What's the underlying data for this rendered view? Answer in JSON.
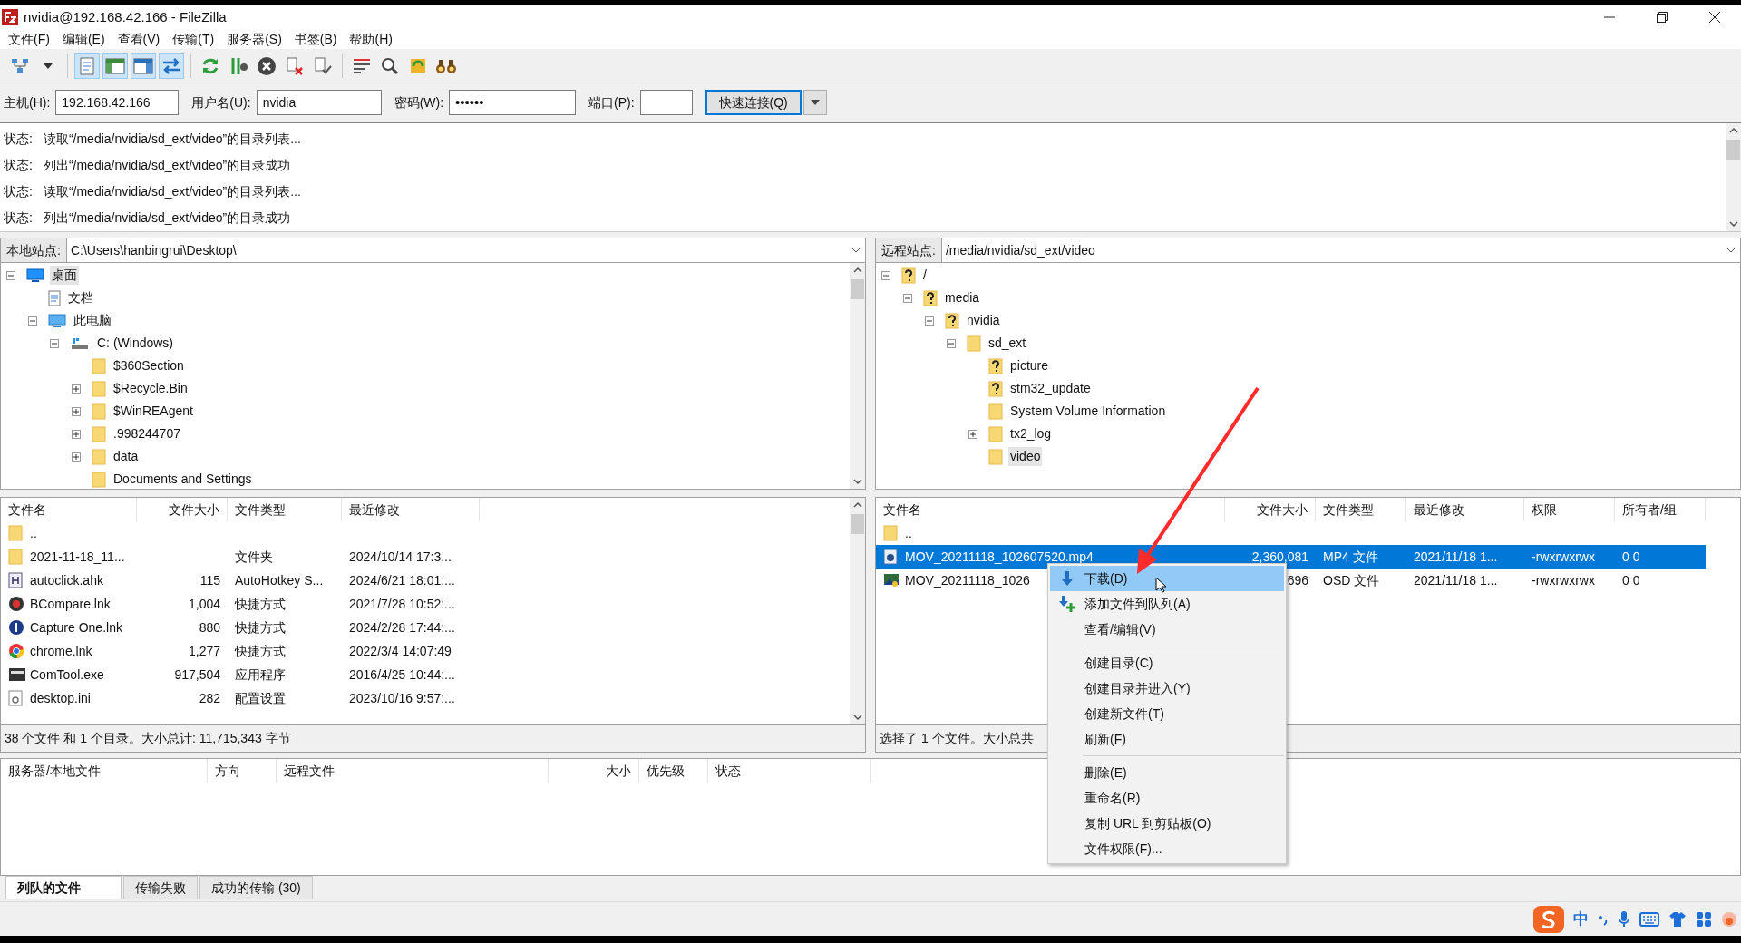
{
  "window": {
    "title": "nvidia@192.168.42.166 - FileZilla"
  },
  "menu": [
    "文件(F)",
    "编辑(E)",
    "查看(V)",
    "传输(T)",
    "服务器(S)",
    "书签(B)",
    "帮助(H)"
  ],
  "toolbar": [
    {
      "kind": "sitemanager"
    },
    {
      "kind": "dropdown"
    },
    {
      "kind": "sep"
    },
    {
      "kind": "log",
      "selected": true
    },
    {
      "kind": "localtree",
      "selected": true
    },
    {
      "kind": "remotetree",
      "selected": true
    },
    {
      "kind": "queue",
      "selected": true
    },
    {
      "kind": "sep"
    },
    {
      "kind": "refresh"
    },
    {
      "kind": "filter"
    },
    {
      "kind": "cancel"
    },
    {
      "kind": "disconnect"
    },
    {
      "kind": "reconnect"
    },
    {
      "kind": "sep"
    },
    {
      "kind": "list"
    },
    {
      "kind": "search"
    },
    {
      "kind": "sync"
    },
    {
      "kind": "find"
    }
  ],
  "quickconnect": {
    "host_label": "主机(H):",
    "host": "192.168.42.166",
    "user_label": "用户名(U):",
    "user": "nvidia",
    "password_label": "密码(W):",
    "password": "••••••",
    "port_label": "端口(P):",
    "connect": "快速连接(Q)"
  },
  "log": [
    {
      "label": "状态:",
      "text": "读取“/media/nvidia/sd_ext/video”的目录列表..."
    },
    {
      "label": "状态:",
      "text": "列出“/media/nvidia/sd_ext/video”的目录成功"
    },
    {
      "label": "状态:",
      "text": "读取“/media/nvidia/sd_ext/video”的目录列表..."
    },
    {
      "label": "状态:",
      "text": "列出“/media/nvidia/sd_ext/video”的目录成功"
    }
  ],
  "local": {
    "site_label": "本地站点:",
    "path": "C:\\Users\\hanbingrui\\Desktop\\",
    "tree": [
      {
        "name": "桌面",
        "kind": "desktop",
        "expanded": true,
        "selected": true,
        "children": [
          {
            "name": "文档",
            "kind": "document",
            "selected": false
          },
          {
            "name": "此电脑",
            "kind": "computer",
            "expanded": true,
            "selected": false,
            "children": [
              {
                "name": "C: (Windows)",
                "kind": "drive",
                "expanded": true,
                "selected": false,
                "children": [
                  {
                    "name": "$360Section",
                    "kind": "folder",
                    "selected": false
                  },
                  {
                    "name": "$Recycle.Bin",
                    "kind": "folder",
                    "expanded": false,
                    "selected": false
                  },
                  {
                    "name": "$WinREAgent",
                    "kind": "folder",
                    "expanded": false,
                    "selected": false
                  },
                  {
                    "name": ".998244707",
                    "kind": "folder",
                    "expanded": false,
                    "selected": false
                  },
                  {
                    "name": "data",
                    "kind": "folder",
                    "expanded": false,
                    "selected": false
                  },
                  {
                    "name": "Documents and Settings",
                    "kind": "folder",
                    "selected": false
                  }
                ]
              }
            ]
          }
        ]
      }
    ],
    "columns": [
      "文件名",
      "文件大小",
      "文件类型",
      "最近修改"
    ],
    "rows": [
      {
        "kind": "folder",
        "name": "..",
        "size": "",
        "type": "",
        "modified": "",
        "selected": false
      },
      {
        "kind": "folder",
        "name": "2021-11-18_11...",
        "type": "文件夹",
        "modified": "2024/10/14 17:3...",
        "selected": false
      },
      {
        "kind": "script",
        "name": "autoclick.ahk",
        "size": "115",
        "type": "AutoHotkey S...",
        "modified": "2024/6/21 18:01:...",
        "selected": false
      },
      {
        "kind": "compare",
        "name": "BCompare.lnk",
        "size": "1,004",
        "type": "快捷方式",
        "modified": "2021/7/28 10:52:...",
        "selected": false
      },
      {
        "kind": "capture",
        "name": "Capture One.lnk",
        "size": "880",
        "type": "快捷方式",
        "modified": "2024/2/28 17:44:...",
        "selected": false
      },
      {
        "kind": "chrome",
        "name": "chrome.lnk",
        "size": "1,277",
        "type": "快捷方式",
        "modified": "2022/3/4 14:07:49",
        "selected": false
      },
      {
        "kind": "exe",
        "name": "ComTool.exe",
        "size": "917,504",
        "type": "应用程序",
        "modified": "2016/4/25 10:44:...",
        "selected": false
      },
      {
        "kind": "ini",
        "name": "desktop.ini",
        "size": "282",
        "type": "配置设置",
        "modified": "2023/10/16 9:57:...",
        "selected": false
      }
    ],
    "status": "38 个文件 和 1 个目录。大小总计: 11,715,343 字节"
  },
  "remote": {
    "site_label": "远程站点:",
    "path": "/media/nvidia/sd_ext/video",
    "tree": [
      {
        "name": "/",
        "kind": "unknown",
        "expanded": true,
        "selected": false,
        "children": [
          {
            "name": "media",
            "kind": "unknown",
            "expanded": true,
            "selected": false,
            "children": [
              {
                "name": "nvidia",
                "kind": "unknown",
                "expanded": true,
                "selected": false,
                "children": [
                  {
                    "name": "sd_ext",
                    "kind": "folder",
                    "expanded": true,
                    "selected": false,
                    "children": [
                      {
                        "name": "picture",
                        "kind": "unknown",
                        "selected": false
                      },
                      {
                        "name": "stm32_update",
                        "kind": "unknown",
                        "selected": false
                      },
                      {
                        "name": "System Volume Information",
                        "kind": "folder",
                        "selected": false
                      },
                      {
                        "name": "tx2_log",
                        "kind": "folder",
                        "expanded": false,
                        "selected": false
                      },
                      {
                        "name": "video",
                        "kind": "folder",
                        "selected": true
                      }
                    ]
                  }
                ]
              }
            ]
          }
        ]
      }
    ],
    "columns": [
      "文件名",
      "文件大小",
      "文件类型",
      "最近修改",
      "权限",
      "所有者/组"
    ],
    "rows": [
      {
        "kind": "folder",
        "name": "..",
        "selected": false
      },
      {
        "kind": "video",
        "name": "MOV_20211118_102607520.mp4",
        "size": "2,360,081",
        "type": "MP4 文件",
        "modified": "2021/11/18 1...",
        "perm": "-rwxrwxrwx",
        "owner": "0 0",
        "selected": true
      },
      {
        "kind": "osd",
        "name": "MOV_20211118_1026",
        "size": "696",
        "type": "OSD 文件",
        "modified": "2021/11/18 1...",
        "perm": "-rwxrwxrwx",
        "owner": "0 0",
        "selected": false
      }
    ],
    "status": "选择了 1 个文件。大小总共"
  },
  "context_menu": {
    "groups": [
      [
        {
          "label": "下载(D)",
          "kind": "download",
          "selected": true
        },
        {
          "label": "添加文件到队列(A)",
          "kind": "enqueue",
          "selected": false
        },
        {
          "label": "查看/编辑(V)",
          "kind": "plain",
          "selected": false
        }
      ],
      [
        {
          "label": "创建目录(C)",
          "kind": "plain",
          "selected": false
        },
        {
          "label": "创建目录并进入(Y)",
          "kind": "plain",
          "selected": false
        },
        {
          "label": "创建新文件(T)",
          "kind": "plain",
          "selected": false
        },
        {
          "label": "刷新(F)",
          "kind": "plain",
          "selected": false
        }
      ],
      [
        {
          "label": "删除(E)",
          "kind": "plain",
          "selected": false
        },
        {
          "label": "重命名(R)",
          "kind": "plain",
          "selected": false
        },
        {
          "label": "复制 URL 到剪贴板(O)",
          "kind": "plain",
          "selected": false
        },
        {
          "label": "文件权限(F)...",
          "kind": "plain",
          "selected": false
        }
      ]
    ]
  },
  "queue": {
    "columns": [
      "服务器/本地文件",
      "方向",
      "远程文件",
      "大小",
      "优先级",
      "状态"
    ]
  },
  "queue_tabs": [
    {
      "label": "列队的文件",
      "selected": true
    },
    {
      "label": "传输失败",
      "selected": false
    },
    {
      "label": "成功的传输 (30)",
      "selected": false
    }
  ],
  "tray": {
    "ime": "中"
  }
}
